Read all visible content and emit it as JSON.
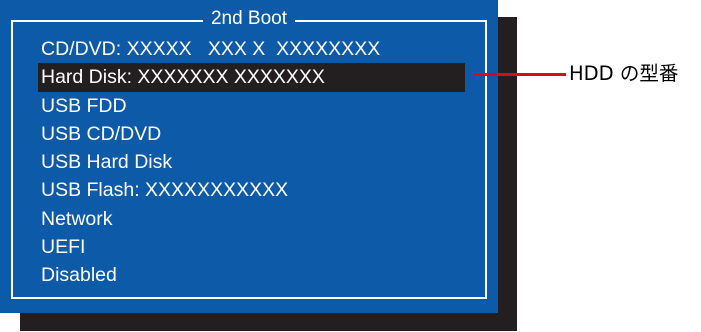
{
  "window": {
    "title": "2nd Boot"
  },
  "menu": {
    "items": [
      {
        "label": "CD/DVD: XXXXX   XXX X  XXXXXXXX",
        "selected": false
      },
      {
        "label": "Hard Disk: XXXXXXX XXXXXXX",
        "selected": true
      },
      {
        "label": "USB FDD",
        "selected": false
      },
      {
        "label": "USB CD/DVD",
        "selected": false
      },
      {
        "label": "USB Hard Disk",
        "selected": false
      },
      {
        "label": "USB Flash: XXXXXXXXXXX",
        "selected": false
      },
      {
        "label": "Network",
        "selected": false
      },
      {
        "label": "UEFI",
        "selected": false
      },
      {
        "label": "Disabled",
        "selected": false
      }
    ]
  },
  "callout": {
    "label": "HDD の型番"
  },
  "colors": {
    "panel_bg": "#0d5aa8",
    "shadow": "#231f20",
    "selection_bg": "#231f20",
    "text": "#ffffff",
    "callout_line": "#e2001a"
  }
}
